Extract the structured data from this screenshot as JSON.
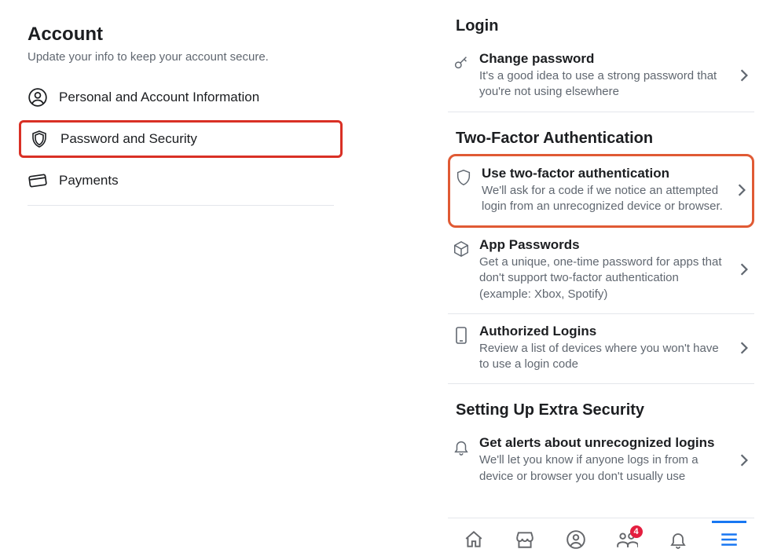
{
  "left": {
    "title": "Account",
    "subtitle": "Update your info to keep your account secure.",
    "items": [
      {
        "label": "Personal and Account Information"
      },
      {
        "label": "Password and Security"
      },
      {
        "label": "Payments"
      }
    ]
  },
  "right": {
    "sections": [
      {
        "header": "Login",
        "items": [
          {
            "title": "Change password",
            "desc": "It's a good idea to use a strong password that you're not using elsewhere"
          }
        ]
      },
      {
        "header": "Two-Factor Authentication",
        "items": [
          {
            "title": "Use two-factor authentication",
            "desc": "We'll ask for a code if we notice an attempted login from an unrecognized device or browser."
          },
          {
            "title": "App Passwords",
            "desc": "Get a unique, one-time password for apps that don't support two-factor authentication (example: Xbox, Spotify)"
          },
          {
            "title": "Authorized Logins",
            "desc": "Review a list of devices where you won't have to use a login code"
          }
        ]
      },
      {
        "header": "Setting Up Extra Security",
        "items": [
          {
            "title": "Get alerts about unrecognized logins",
            "desc": "We'll let you know if anyone logs in from a device or browser you don't usually use"
          }
        ]
      }
    ]
  },
  "tabbar": {
    "badge": "4"
  }
}
